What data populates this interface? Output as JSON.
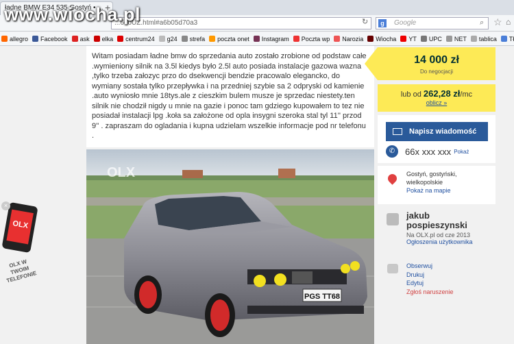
{
  "browser": {
    "tab_title": "ładne BMW E34 535 Gostyń • ...",
    "url": "...6doUZ.html#a6b05d70a3",
    "search_placeholder": "Google",
    "search_engine_letter": "g"
  },
  "watermark": "www.wiocha.pl",
  "bookmarks": [
    {
      "label": "allegro",
      "color": "#ff6600"
    },
    {
      "label": "Facebook",
      "color": "#3b5998"
    },
    {
      "label": "ask",
      "color": "#d22"
    },
    {
      "label": "elka",
      "color": "#c00"
    },
    {
      "label": "centrum24",
      "color": "#d00"
    },
    {
      "label": "g24",
      "color": "#bbb"
    },
    {
      "label": "strefa",
      "color": "#888"
    },
    {
      "label": "poczta onet",
      "color": "#f90"
    },
    {
      "label": "Instagram",
      "color": "#735"
    },
    {
      "label": "Poczta wp",
      "color": "#e33"
    },
    {
      "label": "Narozia",
      "color": "#e55"
    },
    {
      "label": "Wiocha",
      "color": "#600"
    },
    {
      "label": "YT",
      "color": "#e00"
    },
    {
      "label": "UPC",
      "color": "#777"
    },
    {
      "label": "NET",
      "color": "#999"
    },
    {
      "label": "tablica",
      "color": "#aaa"
    },
    {
      "label": "Tłumacz Goog",
      "color": "#4a7ed8"
    }
  ],
  "description": "Witam posiadam ładne bmw do sprzedania auto zostało zrobione od podstaw całe .wymieniony silnik na 3.5l kiedys było 2.5l auto posiada instalacje gazowa wazna ,tylko trzeba załozyc przo do dsekwencji bendzie pracowalo elegancko, do wymiany sostała tylko przepływka i na przedniej szybie sa 2 odpryski od kamienie .auto wyniosło mnie 18tys.ale z cieszkim bulem musze je sprzedac niestety.ten silnik nie chodził nigdy u mnie na gazie i ponoc tam gdziego kupowałem to tez nie posiadał instalacji lpg .koła sa założone od opla insygni szeroka stal tyl 11'' przod 9'' . zapraszam do ogladania i kupna udzielam wszelkie informacje pod nr telefonu .",
  "price": {
    "value": "14 000 zł",
    "note": "Do negocjacji"
  },
  "loan": {
    "prefix": "lub od",
    "amount": "262,28 zł",
    "suffix": "/mc",
    "link": "oblicz »"
  },
  "contact": {
    "button": "Napisz wiadomość",
    "phone": "66x xxx xxx",
    "show_link": "Pokaż"
  },
  "location": {
    "line1": "Gostyń, gostyński,",
    "line2": "wielkopolskie",
    "map_link": "Pokaż na mapie"
  },
  "user": {
    "first": "jakub",
    "last": "pospieszynski",
    "since": "Na OLX.pl od cze 2013",
    "ads_link": "Ogłoszenia użytkownika"
  },
  "actions": [
    "Obserwuj",
    "Drukuj",
    "Edytuj",
    "Zgłoś naruszenie"
  ],
  "ad": {
    "screen": "OLX",
    "text": "OLX W TWOIM TELEFONIE"
  },
  "photo": {
    "plate": "PGS TT68",
    "watermark": "OLX"
  }
}
